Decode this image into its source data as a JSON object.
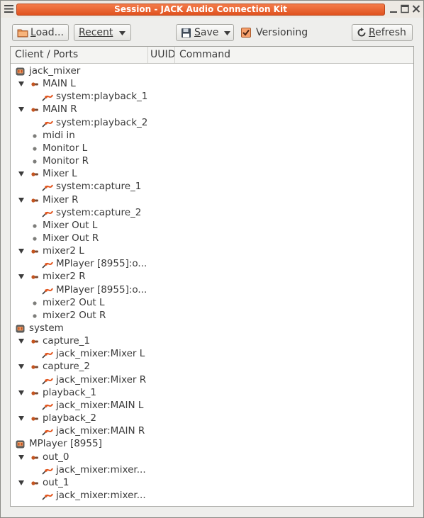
{
  "window": {
    "title": "Session - JACK Audio Connection Kit"
  },
  "toolbar": {
    "load_label": "Load...",
    "load_mnemonic": "L",
    "load_rest": "oad...",
    "recent_label": "Recent",
    "save_label": "Save",
    "save_mnemonic": "S",
    "save_rest": "ave",
    "versioning_label": "Versioning",
    "versioning_mnemonic": "V",
    "versioning_rest": "ersioning",
    "versioning_checked": true,
    "refresh_label": "Refresh",
    "refresh_mnemonic": "R",
    "refresh_rest": "efresh"
  },
  "columns": [
    "Client / Ports",
    "UUID",
    "Command"
  ],
  "colors": {
    "accent": "#e8602c",
    "title_text": "#ffffff",
    "text": "#3c3c3c"
  },
  "tree": [
    {
      "level": 0,
      "type": "client",
      "label": "jack_mixer"
    },
    {
      "level": 1,
      "type": "port",
      "expanded": true,
      "label": "MAIN L"
    },
    {
      "level": 2,
      "type": "conn",
      "label": "system:playback_1"
    },
    {
      "level": 1,
      "type": "port",
      "expanded": true,
      "label": "MAIN R"
    },
    {
      "level": 2,
      "type": "conn",
      "label": "system:playback_2"
    },
    {
      "level": 1,
      "type": "leaf",
      "label": "midi in"
    },
    {
      "level": 1,
      "type": "leaf",
      "label": "Monitor L"
    },
    {
      "level": 1,
      "type": "leaf",
      "label": "Monitor R"
    },
    {
      "level": 1,
      "type": "port",
      "expanded": true,
      "label": "Mixer L"
    },
    {
      "level": 2,
      "type": "conn",
      "label": "system:capture_1"
    },
    {
      "level": 1,
      "type": "port",
      "expanded": true,
      "label": "Mixer R"
    },
    {
      "level": 2,
      "type": "conn",
      "label": "system:capture_2"
    },
    {
      "level": 1,
      "type": "leaf",
      "label": "Mixer Out L"
    },
    {
      "level": 1,
      "type": "leaf",
      "label": "Mixer Out R"
    },
    {
      "level": 1,
      "type": "port",
      "expanded": true,
      "label": "mixer2 L"
    },
    {
      "level": 2,
      "type": "conn",
      "label": "MPlayer [8955]:o..."
    },
    {
      "level": 1,
      "type": "port",
      "expanded": true,
      "label": "mixer2 R"
    },
    {
      "level": 2,
      "type": "conn",
      "label": "MPlayer [8955]:o..."
    },
    {
      "level": 1,
      "type": "leaf",
      "label": "mixer2 Out L"
    },
    {
      "level": 1,
      "type": "leaf",
      "label": "mixer2 Out R"
    },
    {
      "level": 0,
      "type": "client",
      "label": "system"
    },
    {
      "level": 1,
      "type": "port",
      "expanded": true,
      "label": "capture_1"
    },
    {
      "level": 2,
      "type": "conn",
      "label": "jack_mixer:Mixer L"
    },
    {
      "level": 1,
      "type": "port",
      "expanded": true,
      "label": "capture_2"
    },
    {
      "level": 2,
      "type": "conn",
      "label": "jack_mixer:Mixer R"
    },
    {
      "level": 1,
      "type": "port",
      "expanded": true,
      "label": "playback_1"
    },
    {
      "level": 2,
      "type": "conn",
      "label": "jack_mixer:MAIN L"
    },
    {
      "level": 1,
      "type": "port",
      "expanded": true,
      "label": "playback_2"
    },
    {
      "level": 2,
      "type": "conn",
      "label": "jack_mixer:MAIN R"
    },
    {
      "level": 0,
      "type": "client",
      "label": "MPlayer [8955]"
    },
    {
      "level": 1,
      "type": "port",
      "expanded": true,
      "label": "out_0"
    },
    {
      "level": 2,
      "type": "conn",
      "label": "jack_mixer:mixer..."
    },
    {
      "level": 1,
      "type": "port",
      "expanded": true,
      "label": "out_1"
    },
    {
      "level": 2,
      "type": "conn",
      "label": "jack_mixer:mixer..."
    }
  ]
}
